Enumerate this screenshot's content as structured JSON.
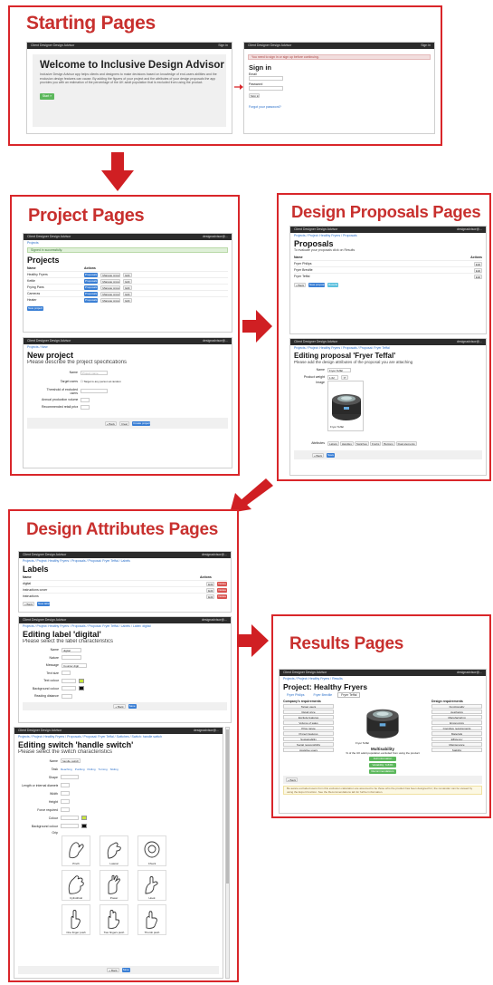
{
  "panels": {
    "starting": "Starting Pages",
    "project": "Project Pages",
    "proposals": "Design Proposals Pages",
    "attributes": "Design Attributes Pages",
    "results": "Results Pages"
  },
  "app": {
    "title": "Client Designer Design Advisor",
    "user": "designadvisor@..."
  },
  "starting": {
    "welcome_title": "Welcome to Inclusive Design Advisor",
    "welcome_body": "Inclusive Design Advisor app helps clients and designers to make decisions based on knowledge of end-users abilities and the exclusion design features can cause. By adding the figures of your project and the attributes of your design proposals the app provides you with an estimation of the percentage of the UK adult population that is excluded from using the product.",
    "start_button": "Start »",
    "alert": "You need to sign in or sign up before continuing.",
    "signin_title": "Sign in",
    "email_label": "Email",
    "password_label": "Password",
    "signin_button": "Sign in",
    "forgot_link": "Forgot your password?"
  },
  "projects": {
    "alert": "Signed in successfully.",
    "title": "Projects",
    "col_name": "Name",
    "col_actions": "Actions",
    "rows": [
      "Healthy Fryers",
      "Kettle",
      "Frying Pans",
      "Cameras",
      "Heater"
    ],
    "proposals_btn": "Proposals",
    "manage_btn": "Manage properties",
    "edit_btn": "Edit",
    "new_btn": "New project"
  },
  "new_project": {
    "breadcrumb": "Projects  /  New",
    "title": "New project",
    "subtitle": "Please describe the project specifications",
    "fields": [
      "Name",
      "Target users",
      "Threshold of excluded users",
      "Annual production volume",
      "Recommended retail price"
    ],
    "name_placeholder": "Project name",
    "target_option": "Target is any person at random",
    "buttons": [
      "« Back",
      "Clear",
      "Create project"
    ]
  },
  "proposals": {
    "breadcrumb": "Projects / Project: Healthy Fryers / Proposals",
    "title": "Proposals",
    "subtitle": "To evaluate your proposals click on Results",
    "col_name": "Name",
    "col_actions": "Actions",
    "rows": [
      "Fryer Philips",
      "Fryer Breville",
      "Fryer Teffal"
    ],
    "edit_btn": "Edit",
    "buttons": [
      "« Back",
      "New proposal",
      "Results"
    ]
  },
  "editing_proposal": {
    "breadcrumb": "Projects / Project: Healthy Fryers / Proposals / Proposal: Fryer Teffal",
    "title": "Editing proposal 'Fryer Teffal'",
    "subtitle": "Please add the design attributes of the proposal you are attaching",
    "name_label": "Name",
    "name_value": "Fryer Teffal",
    "price_label": "Product weight",
    "price_value": "1.62",
    "image_label": "Image",
    "image_caption": "Fryer Teffal",
    "attributes_label": "Attributes",
    "attributes": [
      "Labels",
      "Handles",
      "Switches",
      "Knobs",
      "Buttons",
      "Dual elements"
    ],
    "buttons": [
      "« Back",
      "Save"
    ]
  },
  "labels": {
    "breadcrumb": "Projects / Project: Healthy Fryers / Proposals / Proposal: Fryer Teffal / Labels",
    "title": "Labels",
    "col_name": "Name",
    "col_actions": "Actions",
    "rows": [
      "digital",
      "instructions cover",
      "instructions"
    ],
    "edit_btn": "Edit",
    "delete_btn": "Delete",
    "buttons": [
      "« Back",
      "New label"
    ]
  },
  "editing_label": {
    "breadcrumb": "Projects / Project: Healthy Fryers / Proposals / Proposal: Fryer Teffal / Labels / Label: digital",
    "title": "Editing label 'digital'",
    "subtitle": "Please select the label characteristics",
    "fields": [
      "Name",
      "Nature",
      "Message",
      "Text size",
      "Text colour",
      "Background colour",
      "Reading distance"
    ],
    "name_value": "digital",
    "message_value": "Counter digit",
    "buttons": [
      "« Back",
      "Save"
    ]
  },
  "editing_switch": {
    "breadcrumb": "Projects / Project: Healthy Fryers / Proposals / Proposal: Fryer Teffal / Switches / Switch: handle switch",
    "title": "Editing switch 'handle switch'",
    "subtitle": "Please select the switch characteristics",
    "fields": [
      "Name",
      "Task",
      "Shape",
      "Length or internal diameter",
      "Width",
      "Height",
      "Force required",
      "Colour",
      "Background colour",
      "Grip"
    ],
    "name_value": "handle switch",
    "task_options": [
      "Reaching",
      "Pushing",
      "Pulling",
      "Turning",
      "Sliding"
    ],
    "grips": [
      "Pinch",
      "Lateral",
      "Chuck",
      "Cylindrical",
      "Power",
      "Hook",
      "One finger push",
      "Two fingers push",
      "Thumb push"
    ],
    "buttons": [
      "« Back",
      "Save"
    ]
  },
  "results": {
    "breadcrumb": "Projects / Project: Healthy Fryers / Results",
    "title": "Project: Healthy Fryers",
    "tabs": [
      "Fryer Philips",
      "Fryer Breville",
      "Fryer Teffal"
    ],
    "company_heading": "Company's requirements",
    "company_reqs": [
      "Target users",
      "Retail price",
      "Exclude features",
      "Volume of sales",
      "Price range",
      "Project features",
      "Sustainability",
      "Social responsibility",
      "Assistive users"
    ],
    "design_heading": "Design requirements",
    "design_reqs": [
      "Functionality",
      "Aesthetics",
      "Manufacturing",
      "Ergonomics",
      "Cognitive requirements",
      "Materials",
      "Efficiency",
      "Maintenance",
      "Stability"
    ],
    "image_caption": "Fryer Teffal",
    "usability_title": "Multisability",
    "usability_text": "% of the UK adult population excluded from using the product",
    "excluded_label": "Variability: 6.84%",
    "result_buttons": [
      "Full information",
      "Variability: 6.84%",
      "Recommendations"
    ],
    "back_btn": "« Back",
    "footer_note": "Be aware excluded users from this exclusion calculation are assumed to be those who the product has been designed for; the remainder can be viewed by using the Export function. See the Recommendations tab for further information."
  }
}
